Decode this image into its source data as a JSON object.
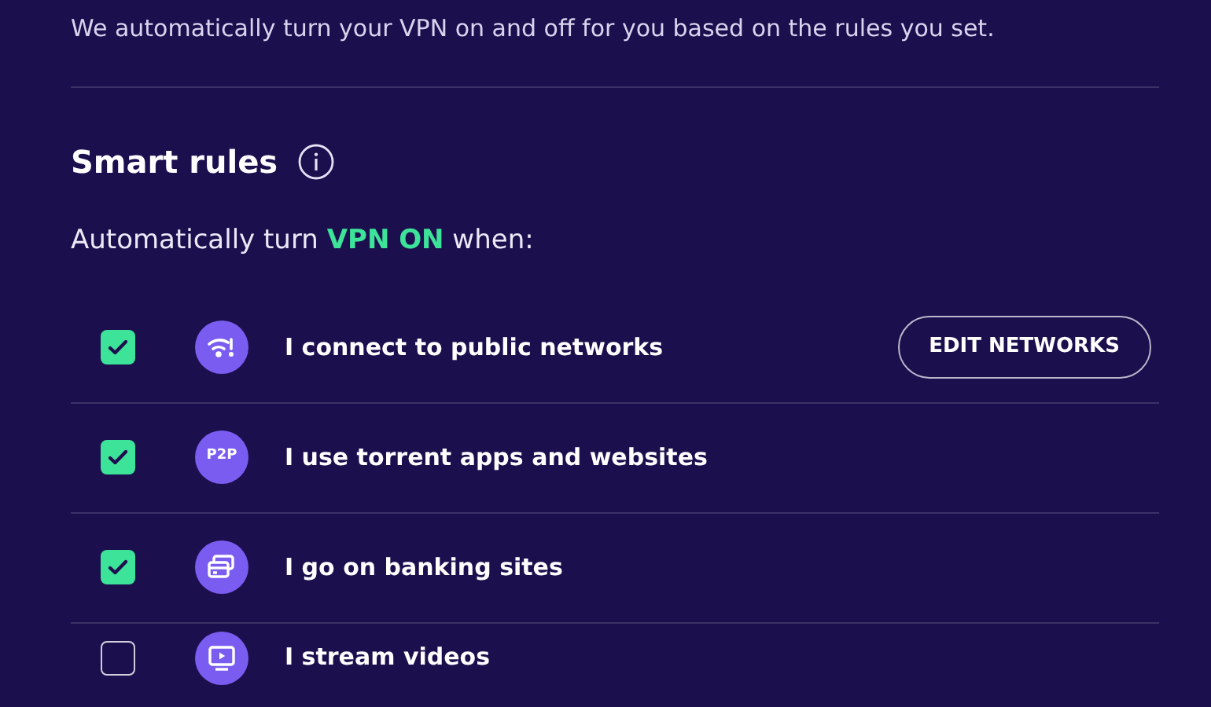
{
  "intro": "We automatically turn your VPN on and off for you based on the rules you set.",
  "heading": "Smart rules",
  "subheading": "Automatically turn **VPN ON** when:",
  "rules": [
    {
      "kind": "wifi",
      "label": "I connect to public networks",
      "checked": true,
      "button": "EDIT NETWORKS"
    },
    {
      "kind": "p2p",
      "icon_text": "P2P",
      "label": "I use torrent apps and websites",
      "checked": true
    },
    {
      "kind": "cards",
      "label": "I go on banking sites",
      "checked": true
    },
    {
      "kind": "play",
      "label": "I stream videos",
      "checked": false
    }
  ]
}
